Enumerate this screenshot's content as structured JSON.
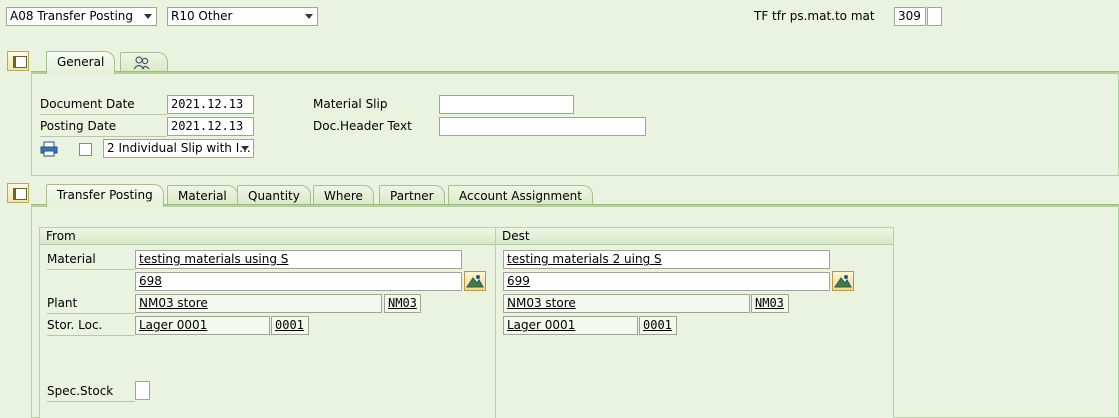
{
  "header": {
    "action_select": "A08 Transfer Posting",
    "ref_select": "R10 Other",
    "movement_label": "TF tfr ps.mat.to mat",
    "movement_type": "309",
    "movement_extra": ""
  },
  "general_tabs": [
    {
      "label": "General",
      "active": true
    },
    {
      "label": "",
      "icon": "people-icon"
    }
  ],
  "general": {
    "document_date_label": "Document Date",
    "document_date": "2021.12.13",
    "posting_date_label": "Posting Date",
    "posting_date": "2021.12.13",
    "material_slip_label": "Material Slip",
    "material_slip": "",
    "doc_header_label": "Doc.Header Text",
    "doc_header": "",
    "print_select": "2 Individual Slip with I..."
  },
  "item_tabs": [
    {
      "label": "Transfer Posting",
      "active": true
    },
    {
      "label": "Material"
    },
    {
      "label": "Quantity"
    },
    {
      "label": "Where"
    },
    {
      "label": "Partner"
    },
    {
      "label": "Account Assignment"
    }
  ],
  "from": {
    "title": "From",
    "material_label": "Material",
    "material_desc": "testing materials using S",
    "material_no": "698",
    "plant_label": "Plant",
    "plant_desc": "NM03 store",
    "plant_code": "NM03",
    "sloc_label": "Stor. Loc.",
    "sloc_desc": "Lager 0001",
    "sloc_code": "0001",
    "spec_stock_label": "Spec.Stock",
    "spec_stock": ""
  },
  "dest": {
    "title": "Dest",
    "material_desc": "testing materials 2 uing S",
    "material_no": "699",
    "plant_desc": "NM03 store",
    "plant_code": "NM03",
    "sloc_desc": "Lager 0001",
    "sloc_code": "0001"
  },
  "colors": {
    "background": "#eaf3df",
    "tab_line": "#b5d099",
    "field_border": "#9aa88f"
  }
}
